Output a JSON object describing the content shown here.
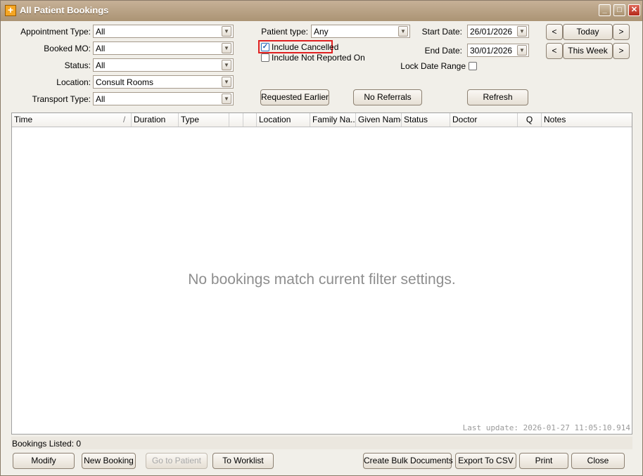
{
  "window": {
    "title": "All Patient Bookings"
  },
  "filters": {
    "appointment_type": {
      "label": "Appointment Type:",
      "value": "All"
    },
    "booked_mo": {
      "label": "Booked MO:",
      "value": "All"
    },
    "status": {
      "label": "Status:",
      "value": "All"
    },
    "location": {
      "label": "Location:",
      "value": "Consult Rooms"
    },
    "transport_type": {
      "label": "Transport Type:",
      "value": "All"
    },
    "patient_type": {
      "label": "Patient type:",
      "value": "Any"
    },
    "include_cancelled": {
      "label": "Include Cancelled",
      "checked": true
    },
    "include_not_reported": {
      "label": "Include Not Reported On",
      "checked": false
    },
    "start_date": {
      "label": "Start Date:",
      "value": "26/01/2026"
    },
    "end_date": {
      "label": "End Date:",
      "value": "30/01/2026"
    },
    "lock_date_range": {
      "label": "Lock Date Range",
      "checked": false
    }
  },
  "nav": {
    "prev": "<",
    "next": ">",
    "today": "Today",
    "this_week": "This Week"
  },
  "actions": {
    "requested_earlier": "Requested Earlier",
    "no_referrals": "No Referrals",
    "refresh": "Refresh"
  },
  "table": {
    "columns": [
      "Time",
      "Duration",
      "Type",
      "",
      "",
      "Location",
      "Family Na...",
      "Given Name",
      "Status",
      "Doctor",
      "Q",
      "Notes"
    ],
    "sort_glyph": "/",
    "empty_message": "No bookings match current filter settings.",
    "last_update": "Last update: 2026-01-27 11:05:10.914"
  },
  "status": {
    "bookings_listed": "Bookings Listed: 0"
  },
  "footer": {
    "modify": "Modify",
    "new_booking": "New Booking",
    "go_to_patient": "Go to Patient",
    "to_worklist": "To Worklist",
    "create_bulk": "Create Bulk Documents",
    "export_csv": "Export To CSV",
    "print": "Print",
    "close": "Close"
  },
  "icons": {
    "dropdown": "chevron-down-icon",
    "app": "plus-cross-icon",
    "check": "checkmark-icon"
  },
  "colors": {
    "titlebar": "#ab9474",
    "highlight_border": "#e02020",
    "checkbox_check": "#1d5db0"
  }
}
